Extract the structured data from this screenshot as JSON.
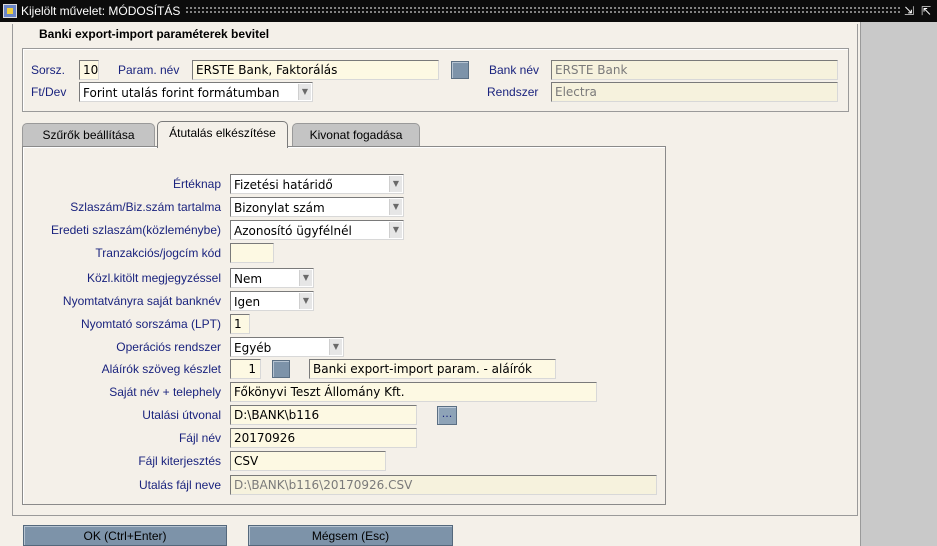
{
  "window": {
    "title": "Kijelölt művelet: MÓDOSÍTÁS"
  },
  "header": {
    "title": "Banki export-import paraméterek bevitel"
  },
  "params": {
    "sorsz_label": "Sorsz.",
    "sorsz_value": "10",
    "param_nev_label": "Param. név",
    "param_nev_value": "ERSTE Bank, Faktorálás",
    "bank_nev_label": "Bank név",
    "bank_nev_value": "ERSTE Bank",
    "ftdev_label": "Ft/Dev",
    "ftdev_value": "Forint utalás forint formátumban",
    "rendszer_label": "Rendszer",
    "rendszer_value": "Electra"
  },
  "tabs": [
    {
      "label": "Szűrők beállítása"
    },
    {
      "label": "Átutalás elkészítése"
    },
    {
      "label": "Kivonat fogadása"
    }
  ],
  "form": {
    "erteknap": {
      "label": "Értéknap",
      "value": "Fizetési határidő"
    },
    "szlaszam": {
      "label": "Szlaszám/Biz.szám tartalma",
      "value": "Bizonylat szám"
    },
    "eredeti": {
      "label": "Eredeti szlaszám(közleménybe)",
      "value": "Azonosító ügyfélnél"
    },
    "tranzakcios": {
      "label": "Tranzakciós/jogcím kód",
      "value": ""
    },
    "kozl": {
      "label": "Közl.kitölt megjegyzéssel",
      "value": "Nem"
    },
    "nyomtatvany": {
      "label": "Nyomtatványra saját banknév",
      "value": "Igen"
    },
    "nyomtato": {
      "label": "Nyomtató sorszáma (LPT)",
      "value": "1"
    },
    "operacios": {
      "label": "Operációs rendszer",
      "value": "Egyéb"
    },
    "alairok": {
      "label": "Aláírók szöveg készlet",
      "num": "1",
      "value": "Banki export-import param. - aláírók"
    },
    "sajat_nev": {
      "label": "Saját név + telephely",
      "value": "Főkönyvi Teszt Állomány Kft."
    },
    "utalasi_utvonal": {
      "label": "Utalási útvonal",
      "value": "D:\\BANK\\b116",
      "button": "..."
    },
    "fajl_nev": {
      "label": "Fájl név",
      "value": "20170926"
    },
    "fajl_kiterjesztes": {
      "label": "Fájl kiterjesztés",
      "value": "CSV"
    },
    "utalas_fajl_neve": {
      "label": "Utalás fájl neve",
      "value": "D:\\BANK\\b116\\20170926.CSV"
    }
  },
  "buttons": {
    "ok": "OK (Ctrl+Enter)",
    "cancel": "Mégsem (Esc)"
  }
}
